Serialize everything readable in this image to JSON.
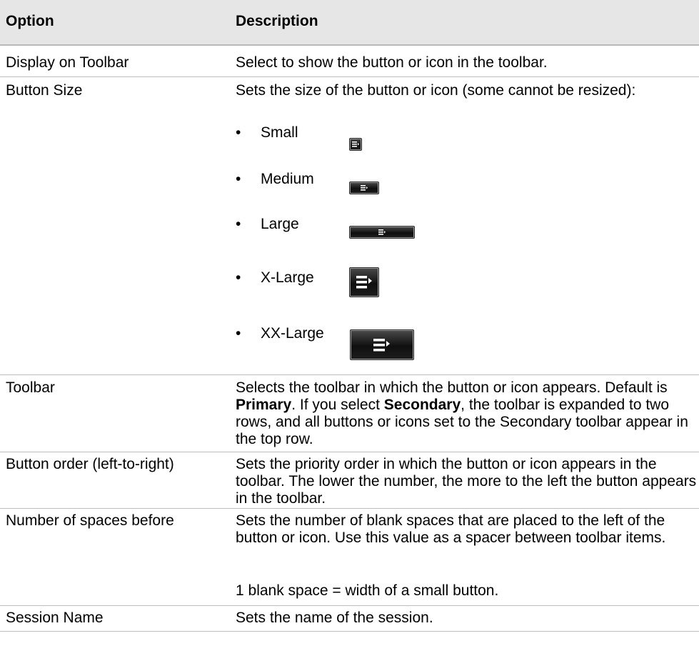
{
  "table": {
    "headers": {
      "option": "Option",
      "description": "Description"
    },
    "rows": {
      "display_on_toolbar": {
        "option": "Display on Toolbar",
        "description": "Select to show the button or icon in the toolbar."
      },
      "button_size": {
        "option": "Button Size",
        "description": "Sets the size of the button or icon (some cannot be resized):",
        "sizes": [
          "Small",
          "Medium",
          "Large",
          "X-Large",
          "XX-Large"
        ]
      },
      "toolbar": {
        "option": "Toolbar",
        "description_part1": "Selects the toolbar in which the button or icon appears. Default is ",
        "bold1": "Primary",
        "description_part2": ". If you select ",
        "bold2": "Secondary",
        "description_part3": ", the toolbar is expanded to two rows, and all buttons or icons set to the Secondary toolbar appear in the top row."
      },
      "button_order": {
        "option": "Button order (left-to-right)",
        "description": "Sets the priority order in which the button or icon appears in the toolbar. The lower the number, the more to the left the button appears in the toolbar."
      },
      "spaces_before": {
        "option": "Number of spaces before",
        "description": "Sets the number of blank spaces that are placed to the left of the button or icon. Use this value as a spacer between toolbar items.",
        "note": "1 blank space = width of a small button."
      },
      "session_name": {
        "option": "Session Name",
        "description": "Sets the name of the session."
      }
    }
  },
  "icons": {
    "toolbar_button_glyph": "menu-arrow-icon"
  }
}
